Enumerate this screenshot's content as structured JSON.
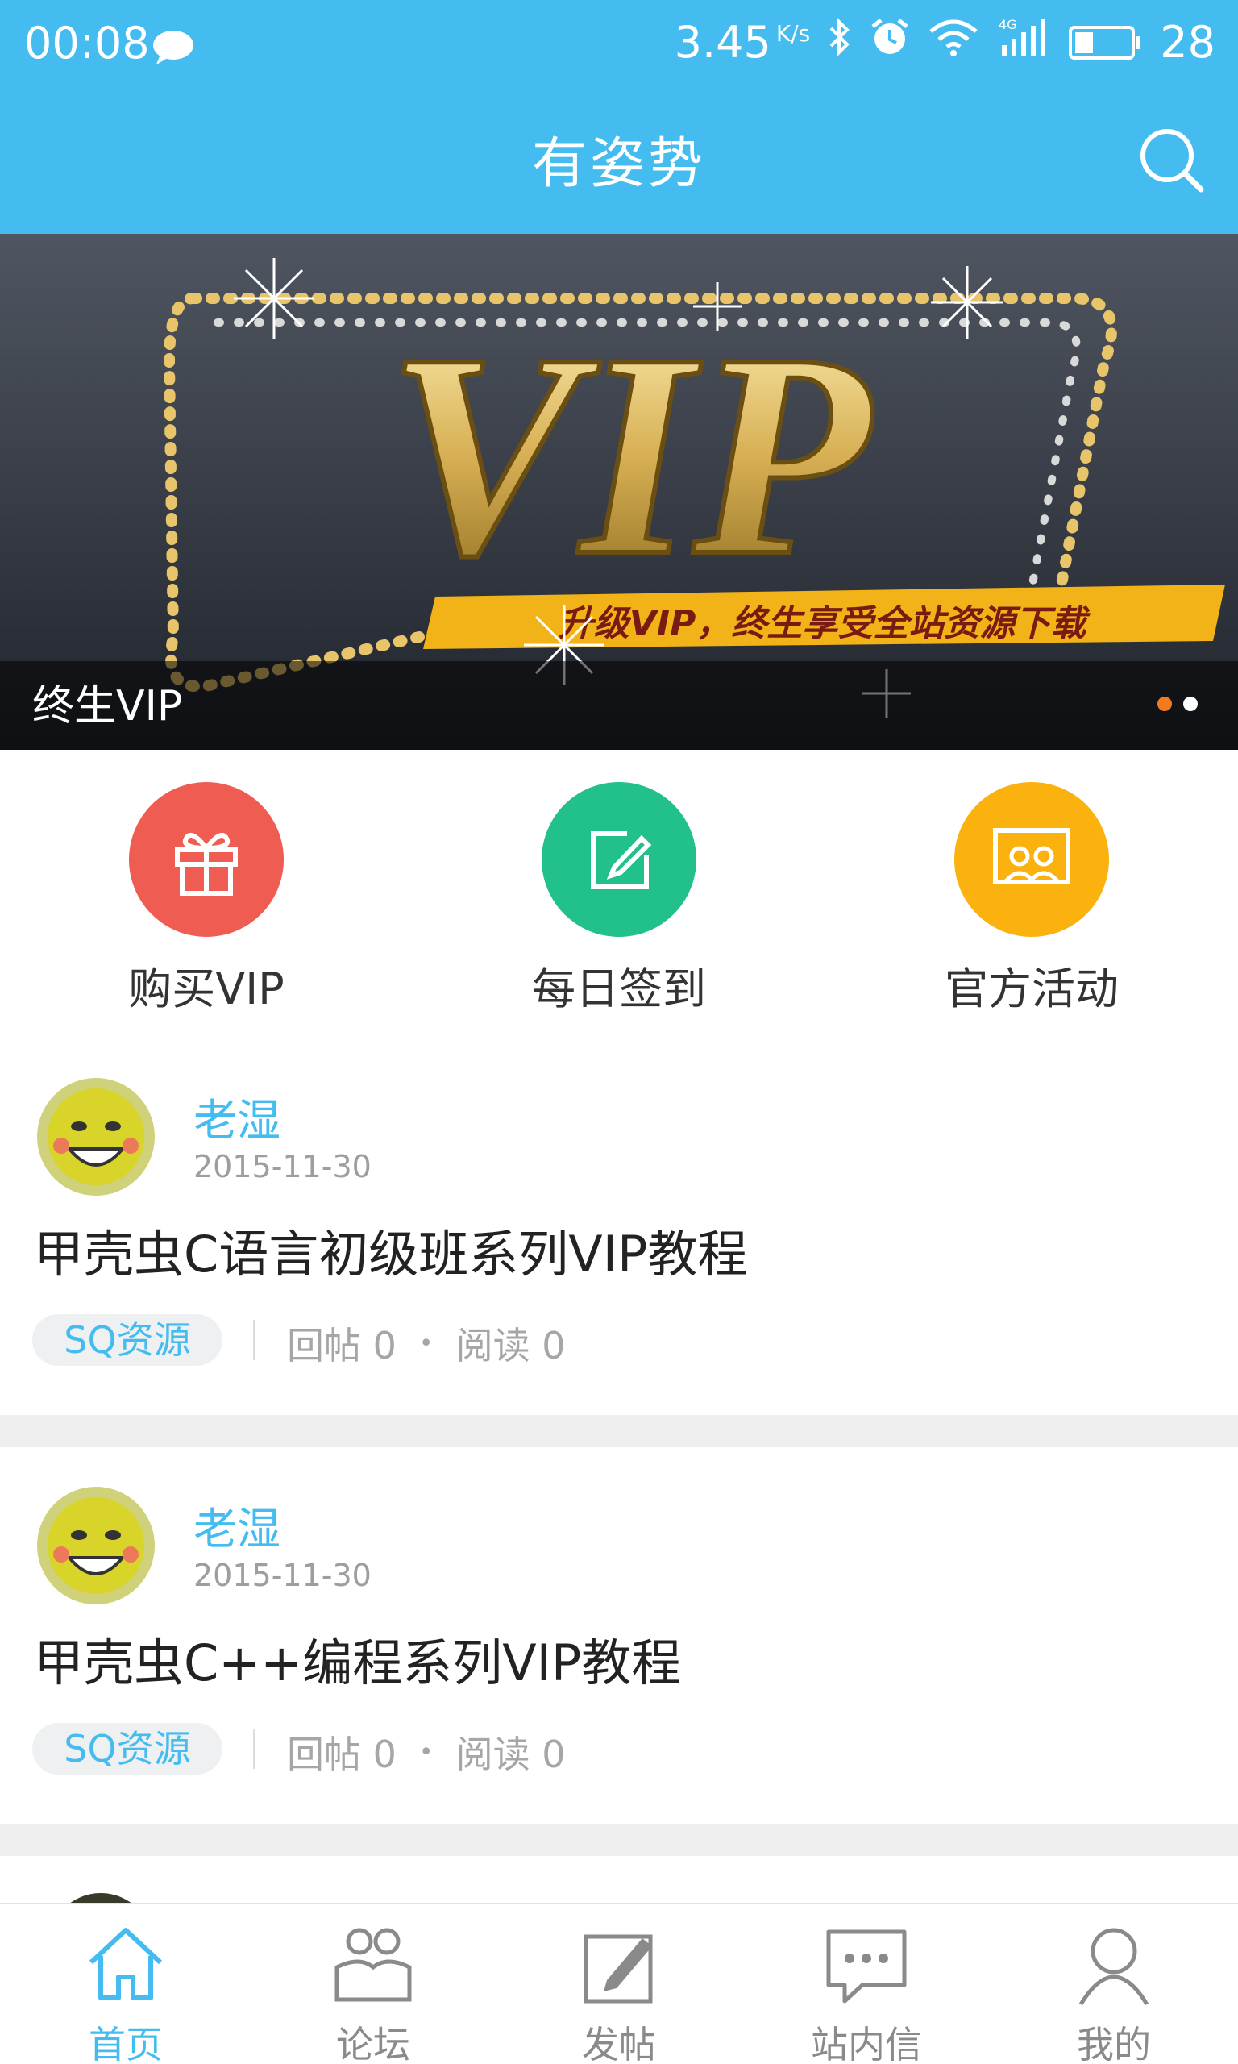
{
  "status_bar": {
    "time": "00:08",
    "speed_value": "3.45",
    "speed_unit": "K/s",
    "battery": "28",
    "icons": [
      "message-bubble-icon",
      "bluetooth-icon",
      "alarm-icon",
      "wifi-icon",
      "signal-4g-icon",
      "battery-icon"
    ]
  },
  "header": {
    "title": "有姿势",
    "search_icon": "search-icon"
  },
  "banner": {
    "caption": "终生VIP",
    "image_text": "VIP",
    "image_subtext": "升级VIP，终生享受全站资源下载",
    "slides": 2,
    "active_slide": 1
  },
  "quick_actions": [
    {
      "label": "购买VIP",
      "icon": "gift-icon",
      "color": "#ef5c51"
    },
    {
      "label": "每日签到",
      "icon": "edit-icon",
      "color": "#22c08a"
    },
    {
      "label": "官方活动",
      "icon": "group-board-icon",
      "color": "#fbb20f"
    }
  ],
  "posts": [
    {
      "author": "老湿",
      "date": "2015-11-30",
      "title": "甲壳虫C语言初级班系列VIP教程",
      "tag": "SQ资源",
      "replies": "回帖 0",
      "reads": "阅读 0"
    },
    {
      "author": "老湿",
      "date": "2015-11-30",
      "title": "甲壳虫C++编程系列VIP教程",
      "tag": "SQ资源",
      "replies": "回帖 0",
      "reads": "阅读 0"
    }
  ],
  "bottom_nav": [
    {
      "label": "首页",
      "icon": "home-icon",
      "active": true
    },
    {
      "label": "论坛",
      "icon": "forum-icon",
      "active": false
    },
    {
      "label": "发帖",
      "icon": "compose-icon",
      "active": false
    },
    {
      "label": "站内信",
      "icon": "message-icon",
      "active": false
    },
    {
      "label": "我的",
      "icon": "profile-icon",
      "active": false
    }
  ],
  "colors": {
    "primary": "#45bcef",
    "dot_active": "#f47a20"
  }
}
